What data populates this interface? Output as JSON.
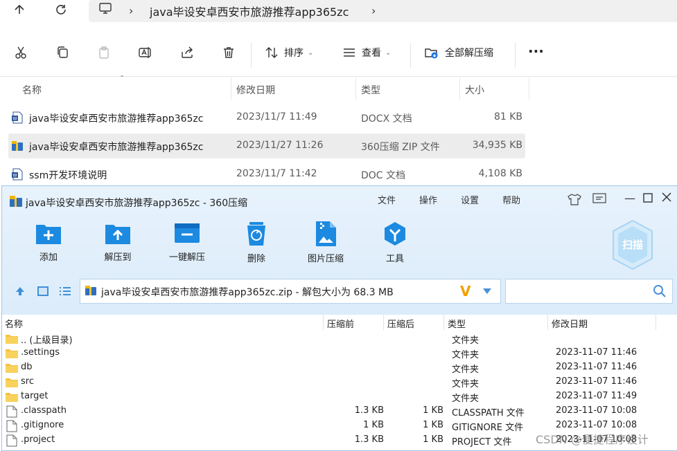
{
  "explorer": {
    "address_path": "java毕设安卓西安市旅游推荐app365zc",
    "toolbar": {
      "sort_label": "排序",
      "view_label": "查看",
      "extract_all_label": "全部解压缩",
      "more_label": "···"
    },
    "columns": {
      "name": "名称",
      "date": "修改日期",
      "type": "类型",
      "size": "大小"
    },
    "files": [
      {
        "name": "java毕设安卓西安市旅游推荐app365zc",
        "date": "2023/11/7 11:49",
        "type": "DOCX 文档",
        "size": "81 KB",
        "icon": "word-doc-icon"
      },
      {
        "name": "java毕设安卓西安市旅游推荐app365zc",
        "date": "2023/11/27 11:26",
        "type": "360压缩 ZIP 文件",
        "size": "34,935 KB",
        "icon": "zip-archive-icon"
      },
      {
        "name": "ssm开发环境说明",
        "date": "2023/11/7 11:42",
        "type": "DOC 文档",
        "size": "4,108 KB",
        "icon": "word-doc-icon"
      }
    ]
  },
  "zip_window": {
    "title": "java毕设安卓西安市旅游推荐app365zc - 360压缩",
    "menu": [
      "文件",
      "操作",
      "设置",
      "帮助"
    ],
    "tools": [
      {
        "label": "添加",
        "icon": "add-folder-icon"
      },
      {
        "label": "解压到",
        "icon": "extract-to-icon"
      },
      {
        "label": "一键解压",
        "icon": "one-click-extract-icon"
      },
      {
        "label": "删除",
        "icon": "recycle-bin-icon"
      },
      {
        "label": "图片压缩",
        "icon": "image-compress-icon"
      },
      {
        "label": "工具",
        "icon": "tools-icon"
      }
    ],
    "scan_label": "扫描",
    "path_text": "java毕设安卓西安市旅游推荐app365zc.zip - 解包大小为 68.3 MB",
    "columns": {
      "name": "名称",
      "pre": "压缩前",
      "post": "压缩后",
      "type": "类型",
      "date": "修改日期"
    },
    "entries": [
      {
        "name": ".. (上级目录)",
        "pre": "",
        "post": "",
        "type": "文件夹",
        "date": "",
        "kind": "folder"
      },
      {
        "name": ".settings",
        "pre": "",
        "post": "",
        "type": "文件夹",
        "date": "2023-11-07 11:46",
        "kind": "folder"
      },
      {
        "name": "db",
        "pre": "",
        "post": "",
        "type": "文件夹",
        "date": "2023-11-07 11:46",
        "kind": "folder"
      },
      {
        "name": "src",
        "pre": "",
        "post": "",
        "type": "文件夹",
        "date": "2023-11-07 11:46",
        "kind": "folder"
      },
      {
        "name": "target",
        "pre": "",
        "post": "",
        "type": "文件夹",
        "date": "2023-11-07 11:49",
        "kind": "folder"
      },
      {
        "name": ".classpath",
        "pre": "1.3 KB",
        "post": "1 KB",
        "type": "CLASSPATH 文件",
        "date": "2023-11-07 10:08",
        "kind": "file"
      },
      {
        "name": ".gitignore",
        "pre": "1 KB",
        "post": "1 KB",
        "type": "GITIGNORE 文件",
        "date": "2023-11-07 10:08",
        "kind": "file"
      },
      {
        "name": ".project",
        "pre": "1.3 KB",
        "post": "1 KB",
        "type": "PROJECT 文件",
        "date": "2023-11-07 10:08",
        "kind": "file"
      }
    ]
  },
  "watermark": "CSDN @便捷程序设计"
}
